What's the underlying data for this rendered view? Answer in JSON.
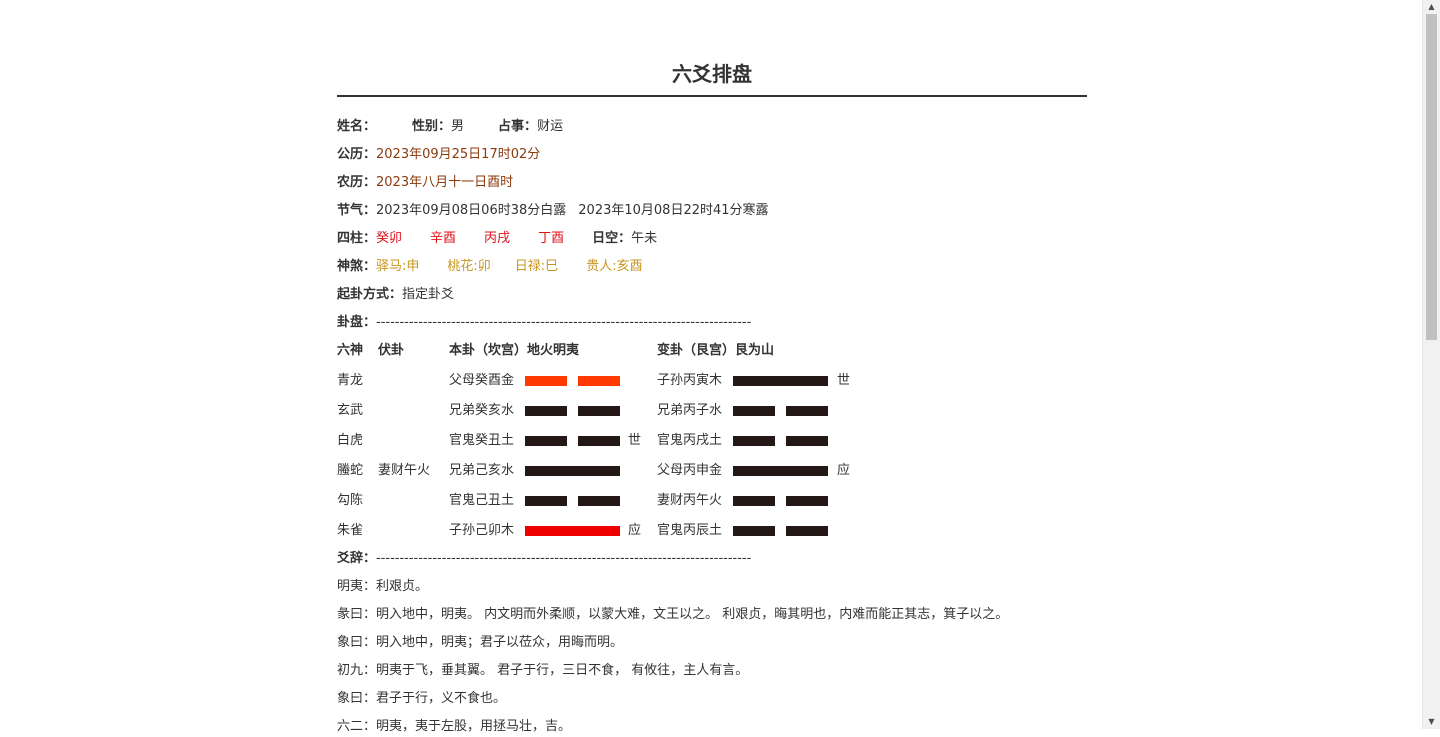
{
  "title": "六爻排盘",
  "info": {
    "name_label": "姓名：",
    "name_value": "",
    "gender_label": "性别：",
    "gender_value": "男",
    "matter_label": "占事：",
    "matter_value": "财运",
    "solar_label": "公历：",
    "solar_value": "2023年09月25日17时02分",
    "lunar_label": "农历：",
    "lunar_value": "2023年八月十一日酉时",
    "jieqi_label": "节气：",
    "jieqi_value1": "2023年09月08日06时38分白露",
    "jieqi_value2": "2023年10月08日22时41分寒露",
    "pillars_label": "四柱：",
    "pillars": [
      "癸卯",
      "辛酉",
      "丙戌",
      "丁酉"
    ],
    "kong_label": "日空：",
    "kong_value": "午未",
    "shensha_label": "神煞：",
    "shensha": [
      "驿马:申",
      "桃花:卯",
      "日禄:巳",
      "贵人:亥酉"
    ],
    "method_label": "起卦方式：",
    "method_value": "指定卦爻",
    "pan_label": "卦盘：",
    "dashes": "--------------------------------------------------------------------------------"
  },
  "table": {
    "h_liushen": "六神",
    "h_fugua": "伏卦",
    "h_bengua": "本卦（坎宫）地火明夷",
    "h_biangua": "变卦（艮宫）艮为山",
    "rows": [
      {
        "liushen": "青龙",
        "fu": "",
        "ben": "父母癸酉金",
        "ben_line": "yin",
        "ben_color": "orange",
        "ben_mark": "",
        "bian": "子孙丙寅木",
        "bian_line": "yang",
        "bian_mark": "世"
      },
      {
        "liushen": "玄武",
        "fu": "",
        "ben": "兄弟癸亥水",
        "ben_line": "yin",
        "ben_color": "dark",
        "ben_mark": "",
        "bian": "兄弟丙子水",
        "bian_line": "yin",
        "bian_mark": ""
      },
      {
        "liushen": "白虎",
        "fu": "",
        "ben": "官鬼癸丑土",
        "ben_line": "yin",
        "ben_color": "dark",
        "ben_mark": "世",
        "bian": "官鬼丙戌土",
        "bian_line": "yin",
        "bian_mark": ""
      },
      {
        "liushen": "螣蛇",
        "fu": "妻财午火",
        "ben": "兄弟己亥水",
        "ben_line": "yang",
        "ben_color": "dark",
        "ben_mark": "",
        "bian": "父母丙申金",
        "bian_line": "yang",
        "bian_mark": "应"
      },
      {
        "liushen": "勾陈",
        "fu": "",
        "ben": "官鬼己丑土",
        "ben_line": "yin",
        "ben_color": "dark",
        "ben_mark": "",
        "bian": "妻财丙午火",
        "bian_line": "yin",
        "bian_mark": ""
      },
      {
        "liushen": "朱雀",
        "fu": "",
        "ben": "子孙己卯木",
        "ben_line": "yang",
        "ben_color": "red",
        "ben_mark": "应",
        "bian": "官鬼丙辰土",
        "bian_line": "yin",
        "bian_mark": ""
      }
    ]
  },
  "yaoci": {
    "label": "爻辞：",
    "dashes": "--------------------------------------------------------------------------------",
    "lines": [
      "明夷：利艰贞。",
      "彖曰：明入地中，明夷。 内文明而外柔顺，以蒙大难，文王以之。 利艰贞，晦其明也，内难而能正其志，箕子以之。",
      "象曰：明入地中，明夷；君子以莅众，用晦而明。",
      "初九：明夷于飞，垂其翼。 君子于行，三日不食， 有攸往，主人有言。",
      "象曰：君子于行，义不食也。",
      "六二：明夷，夷于左股，用拯马壮，吉。"
    ]
  },
  "colors": {
    "yin_yang_dark": "#231815",
    "moving_orange": "#ff3a00",
    "moving_red": "#ec0000",
    "brown_text": "#8b3a0e",
    "red_text": "#e0141e",
    "gold_text": "#c8961e"
  }
}
